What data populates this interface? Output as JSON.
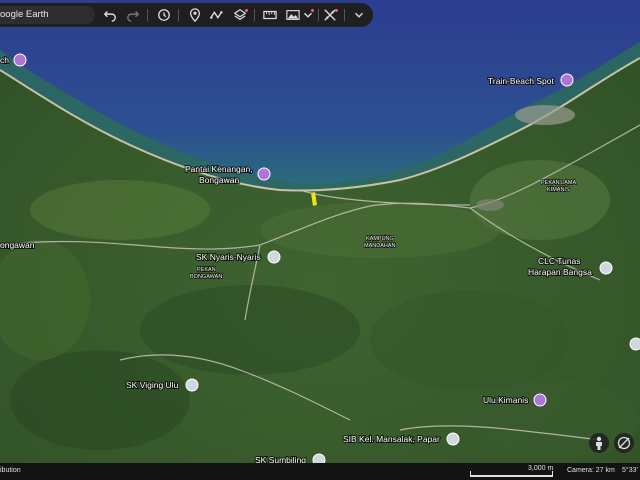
{
  "toolbar": {
    "search_text": "oogle Earth",
    "icons": [
      "undo-icon",
      "redo-icon",
      "history-icon",
      "placemark-icon",
      "path-icon",
      "layers-icon",
      "ruler-icon",
      "image-overlay-icon",
      "measure-icon",
      "expand-icon"
    ]
  },
  "map": {
    "places": [
      {
        "label": "ch",
        "icon": "camera"
      },
      {
        "label": "Train-Beach Spot",
        "icon": "camera"
      },
      {
        "label_line1": "Pantai Kenangan,",
        "label_line2": "Bongawan",
        "icon": "camera"
      },
      {
        "label": "SK Nyaris-Nyaris",
        "icon": "school"
      },
      {
        "label_line1": "CLC Tunas",
        "label_line2": "Harapan Bangsa",
        "icon": "school"
      },
      {
        "label": "SK Viging Ulu",
        "icon": "school"
      },
      {
        "label": "Ulu Kimanis",
        "icon": "camera"
      },
      {
        "label": "SIB Kel. Mansalak, Papar",
        "icon": "church"
      },
      {
        "label": "SK Sumbiling",
        "icon": "school"
      }
    ],
    "area_labels": {
      "bongawan_edge": "ongawan",
      "pekan_bongawan_1": "PEKAN",
      "pekan_bongawan_2": "BONGAWAN",
      "kampung_1": "KAMPUNG",
      "kampung_2": "MANDAHAN",
      "pekan_lama_1": "PEKAN LAMA",
      "pekan_lama_2": "KIMANIS"
    }
  },
  "status": {
    "attribution": "ibution",
    "scale": "3,000 m",
    "camera": "Camera: 27 km",
    "coords": "5°33'"
  },
  "colors": {
    "sea_deep": "#2f3f8c",
    "sea_shallow": "#2c6b7a",
    "land": "#3b5e2e",
    "place_pin_camera": "#b073d6",
    "place_pin_school": "#cfd8dc",
    "highlight": "#f0e21a"
  }
}
